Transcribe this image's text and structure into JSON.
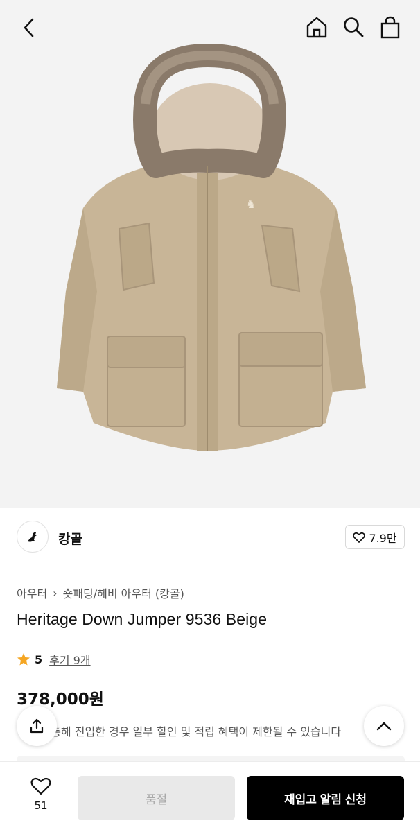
{
  "nav": {
    "back_icon": "chevron-left-icon",
    "home_icon": "home-icon",
    "search_icon": "search-icon",
    "bag_icon": "shopping-bag-icon"
  },
  "hero": {
    "image_subject": "beige parka jacket with fur hood"
  },
  "brand": {
    "name": "캉골",
    "likes": "7.9만"
  },
  "product": {
    "breadcrumb": [
      "아우터",
      "숏패딩/헤비 아우터 (캉골)"
    ],
    "title": "Heritage Down Jumper 9536 Beige",
    "rating": "5",
    "reviews": "후기 9개",
    "price": "378,000원",
    "notice": "링크를 통해 진입한 경우 일부 할인 및 적립 혜택이 제한될 수 있습니다"
  },
  "colors": {
    "star": "#f5a623",
    "primary_button": "#000000",
    "disabled_button": "#e9e9e9"
  },
  "bottom": {
    "wish_count": "51",
    "soldout_label": "품절",
    "restock_label": "재입고 알림 신청"
  }
}
